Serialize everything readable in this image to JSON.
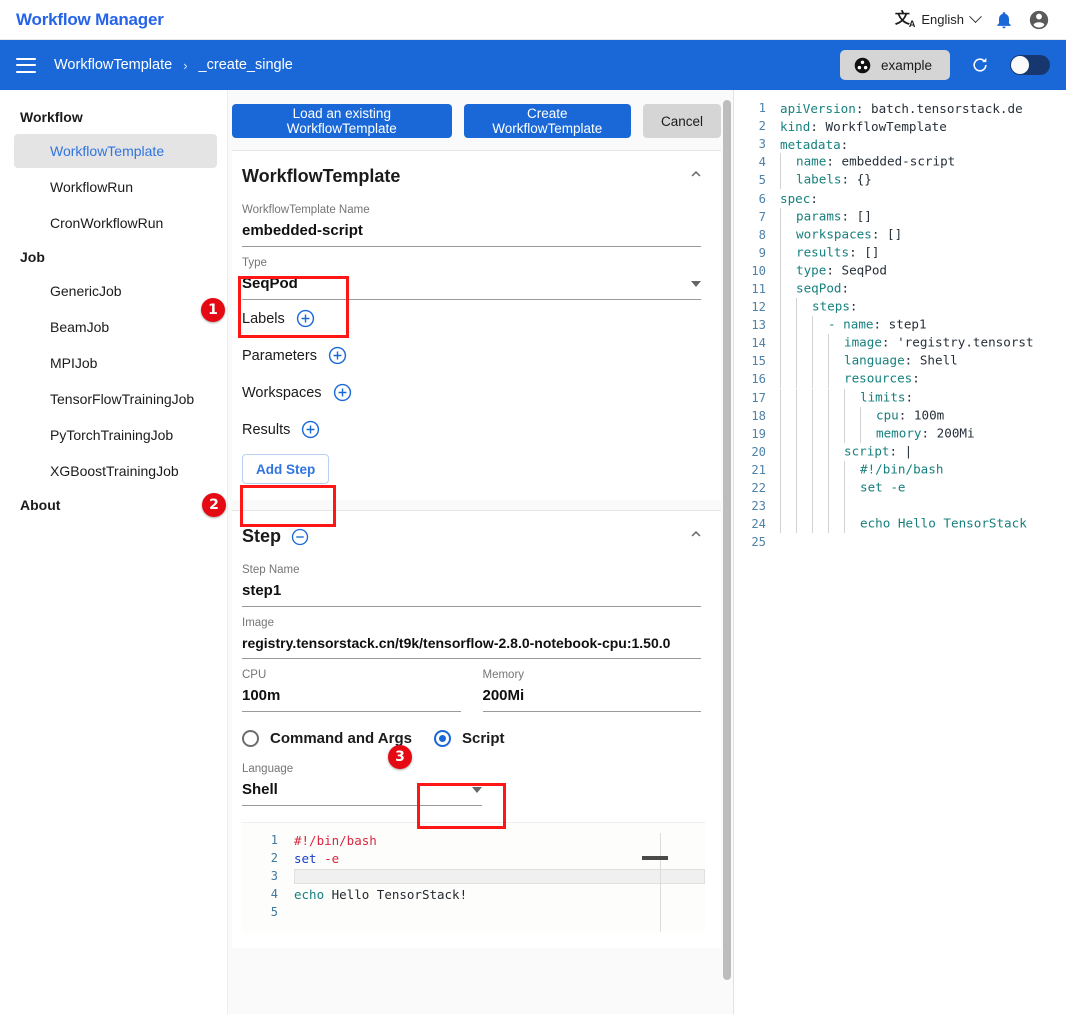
{
  "app": {
    "title": "Workflow Manager",
    "language_label": "English",
    "language_icon": "translate-icon",
    "bell_icon": "notification-bell-icon",
    "account_icon": "account-circle-icon"
  },
  "breadcrumb": {
    "menu_icon": "hamburger-menu-icon",
    "items": [
      "WorkflowTemplate",
      "_create_single"
    ],
    "separator": "›",
    "project_button": {
      "label": "example",
      "icon": "project-dot-icon"
    },
    "refresh_icon": "refresh-icon",
    "toggle_state": "off"
  },
  "sidebar": {
    "groups": [
      {
        "label": "Workflow",
        "items": [
          {
            "label": "WorkflowTemplate",
            "active": true
          },
          {
            "label": "WorkflowRun",
            "active": false
          },
          {
            "label": "CronWorkflowRun",
            "active": false
          }
        ]
      },
      {
        "label": "Job",
        "items": [
          {
            "label": "GenericJob",
            "active": false
          },
          {
            "label": "BeamJob",
            "active": false
          },
          {
            "label": "MPIJob",
            "active": false
          },
          {
            "label": "TensorFlowTrainingJob",
            "active": false
          },
          {
            "label": "PyTorchTrainingJob",
            "active": false
          },
          {
            "label": "XGBoostTrainingJob",
            "active": false
          }
        ]
      },
      {
        "label": "About",
        "items": []
      }
    ]
  },
  "toolbar": {
    "load_label": "Load an existing WorkflowTemplate",
    "create_label": "Create WorkflowTemplate",
    "cancel_label": "Cancel"
  },
  "template_card": {
    "title": "WorkflowTemplate",
    "name_label": "WorkflowTemplate Name",
    "name_value": "embedded-script",
    "type_label": "Type",
    "type_value": "SeqPod",
    "add_rows": [
      {
        "label": "Labels",
        "icon": "add-circle-icon"
      },
      {
        "label": "Parameters",
        "icon": "add-circle-icon"
      },
      {
        "label": "Workspaces",
        "icon": "add-circle-icon"
      },
      {
        "label": "Results",
        "icon": "add-circle-icon"
      }
    ],
    "add_step_label": "Add Step"
  },
  "step_card": {
    "title": "Step",
    "remove_icon": "remove-circle-icon",
    "step_name_label": "Step Name",
    "step_name_value": "step1",
    "image_label": "Image",
    "image_value": "registry.tensorstack.cn/t9k/tensorflow-2.8.0-notebook-cpu:1.50.0",
    "cpu_label": "CPU",
    "cpu_value": "100m",
    "memory_label": "Memory",
    "memory_value": "200Mi",
    "radio_command_label": "Command and Args",
    "radio_script_label": "Script",
    "radio_selected": "Script",
    "language_label": "Language",
    "language_value": "Shell"
  },
  "script_editor": {
    "lines": [
      {
        "n": "1",
        "tokens": [
          {
            "t": "#!/bin/bash",
            "c": "red"
          }
        ]
      },
      {
        "n": "2",
        "tokens": [
          {
            "t": "set",
            "c": "blue"
          },
          {
            "t": " ",
            "c": "dark"
          },
          {
            "t": "-e",
            "c": "red"
          }
        ]
      },
      {
        "n": "3",
        "tokens": [],
        "cursor": true
      },
      {
        "n": "4",
        "tokens": [
          {
            "t": "echo",
            "c": "teal"
          },
          {
            "t": " Hello TensorStack!",
            "c": "dark"
          }
        ]
      },
      {
        "n": "5",
        "tokens": []
      }
    ]
  },
  "yaml_panel": {
    "lines": [
      {
        "n": "1",
        "indent": 0,
        "key": "apiVersion",
        "val": " batch.tensorstack.de"
      },
      {
        "n": "2",
        "indent": 0,
        "key": "kind",
        "val": " WorkflowTemplate"
      },
      {
        "n": "3",
        "indent": 0,
        "key": "metadata",
        "val": ""
      },
      {
        "n": "4",
        "indent": 1,
        "key": "name",
        "val": " embedded-script"
      },
      {
        "n": "5",
        "indent": 1,
        "key": "labels",
        "val": " {}"
      },
      {
        "n": "6",
        "indent": 0,
        "key": "spec",
        "val": ""
      },
      {
        "n": "7",
        "indent": 1,
        "key": "params",
        "val": " []"
      },
      {
        "n": "8",
        "indent": 1,
        "key": "workspaces",
        "val": " []"
      },
      {
        "n": "9",
        "indent": 1,
        "key": "results",
        "val": " []"
      },
      {
        "n": "10",
        "indent": 1,
        "key": "type",
        "val": " SeqPod"
      },
      {
        "n": "11",
        "indent": 1,
        "key": "seqPod",
        "val": ""
      },
      {
        "n": "12",
        "indent": 2,
        "key": "steps",
        "val": ""
      },
      {
        "n": "13",
        "indent": 3,
        "key": "- name",
        "val": " step1",
        "dash": true
      },
      {
        "n": "14",
        "indent": 4,
        "key": "image",
        "val": " 'registry.tensorst"
      },
      {
        "n": "15",
        "indent": 4,
        "key": "language",
        "val": " Shell"
      },
      {
        "n": "16",
        "indent": 4,
        "key": "resources",
        "val": ""
      },
      {
        "n": "17",
        "indent": 5,
        "key": "limits",
        "val": ""
      },
      {
        "n": "18",
        "indent": 6,
        "key": "cpu",
        "val": " 100m"
      },
      {
        "n": "19",
        "indent": 6,
        "key": "memory",
        "val": " 200Mi"
      },
      {
        "n": "20",
        "indent": 4,
        "key": "script",
        "val": " |"
      },
      {
        "n": "21",
        "indent": 5,
        "raw": "#!/bin/bash"
      },
      {
        "n": "22",
        "indent": 5,
        "raw": "set -e"
      },
      {
        "n": "23",
        "indent": 5,
        "raw": ""
      },
      {
        "n": "24",
        "indent": 5,
        "raw": "echo Hello TensorStack"
      },
      {
        "n": "25",
        "indent": 0,
        "raw": ""
      }
    ]
  },
  "annotations": {
    "badges": [
      {
        "num": "1",
        "target": "type-field"
      },
      {
        "num": "2",
        "target": "add-step-button"
      },
      {
        "num": "3",
        "target": "script-radio"
      }
    ]
  }
}
